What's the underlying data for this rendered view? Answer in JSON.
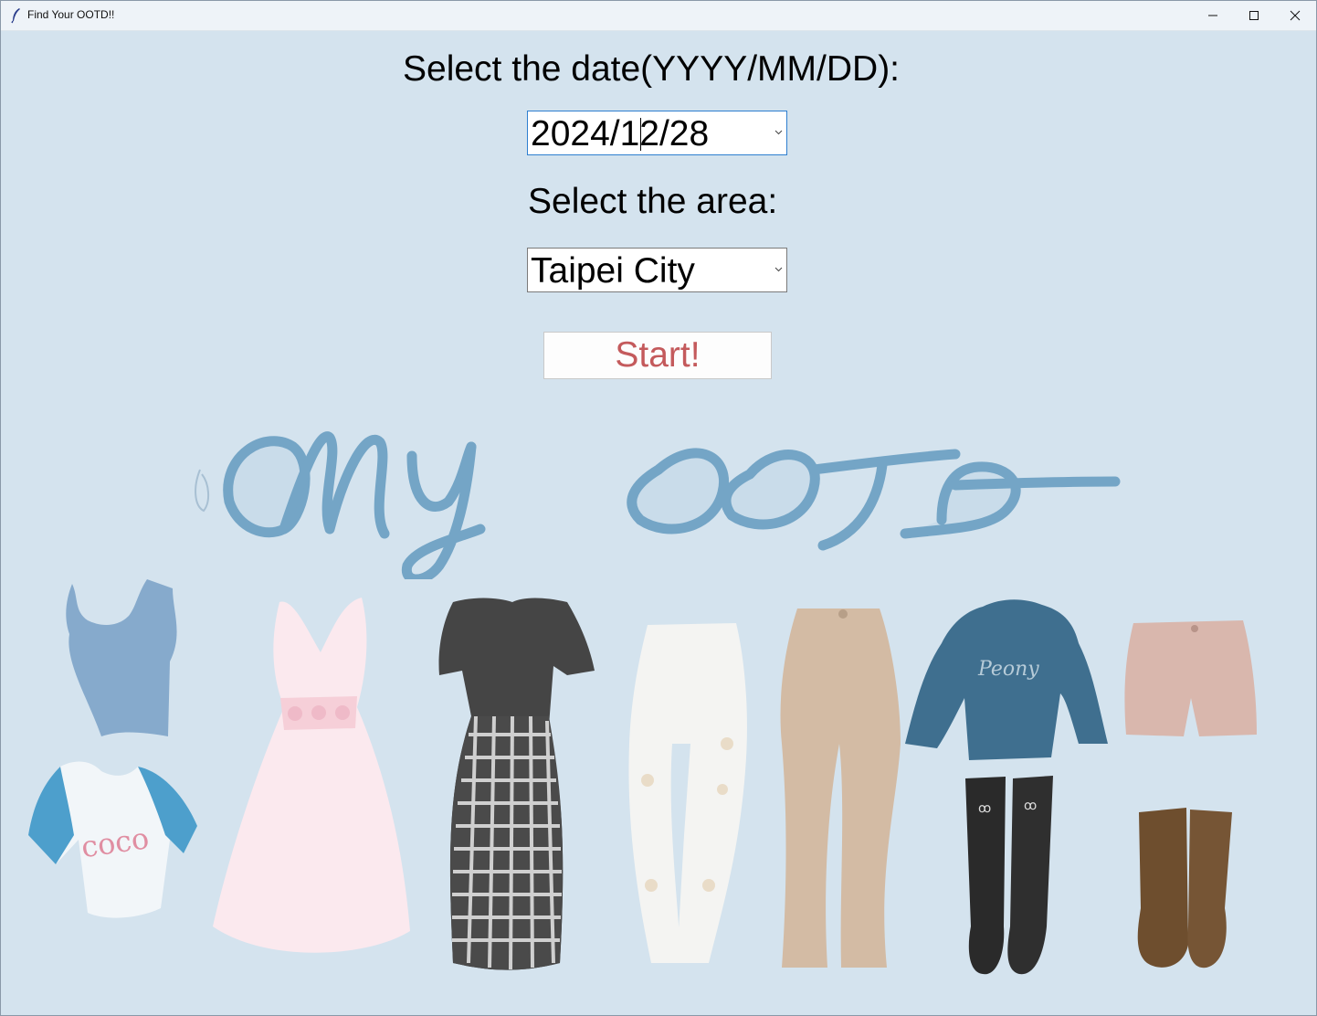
{
  "window": {
    "title": "Find Your OOTD!!",
    "controls": [
      "minimize-icon",
      "maximize-icon",
      "close-icon"
    ]
  },
  "form": {
    "date_label": "Select the date(YYYY/MM/DD):",
    "date_value": "2024/12/28",
    "area_label": "Select the area:",
    "area_value": "Taipei City",
    "start_label": "Start!"
  },
  "colors": {
    "background": "#d4e3ee",
    "start_text": "#c45a5c",
    "logo_stroke": "#74a5c6"
  },
  "illustration": {
    "logo_text": "my OOTD",
    "items": [
      "tank-top",
      "coco-t-shirt",
      "pink-dress",
      "plaid-dress",
      "white-jeans",
      "beige-flare-pants",
      "blue-sweater",
      "black-boots",
      "pink-shorts",
      "brown-boots"
    ]
  }
}
